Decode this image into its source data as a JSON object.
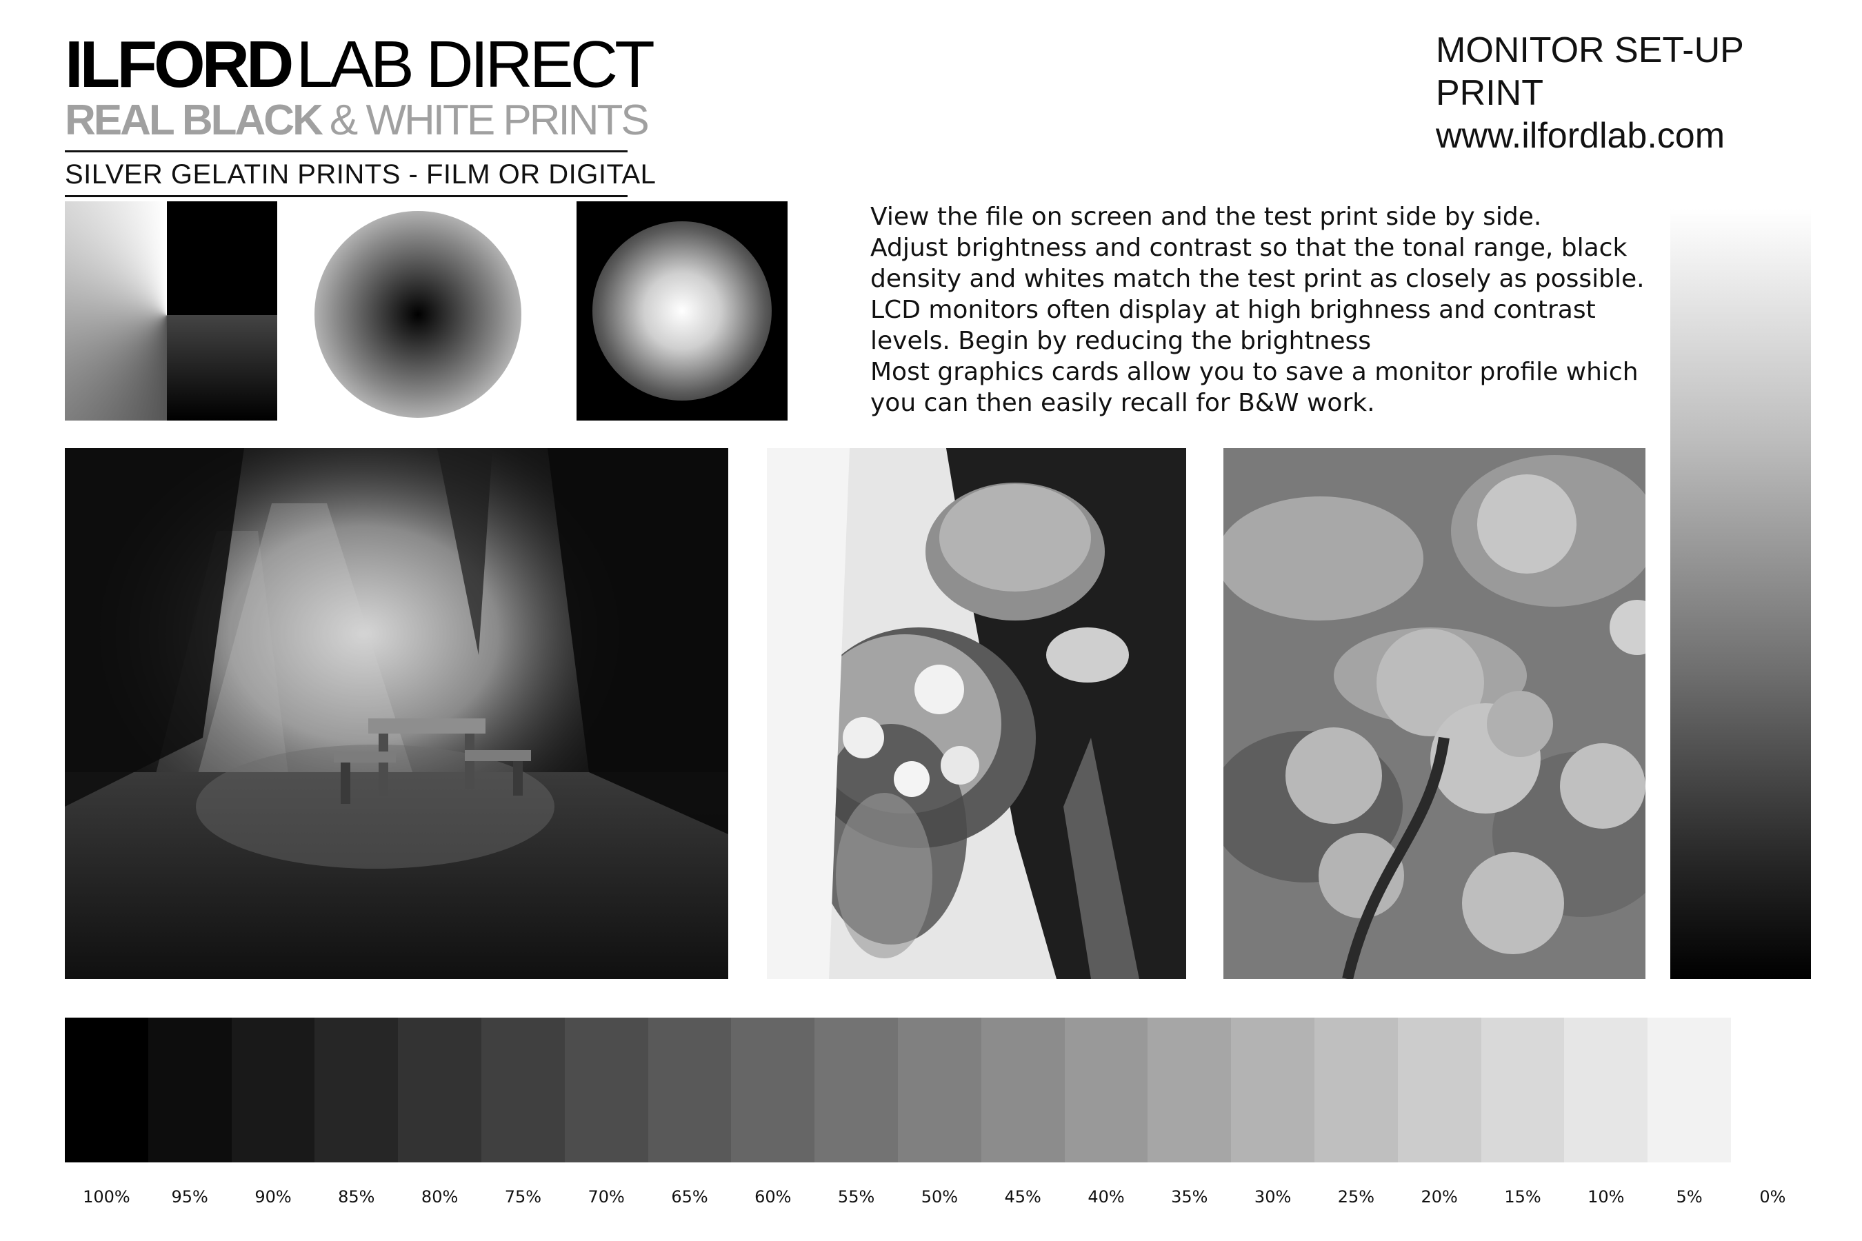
{
  "logo": {
    "line1_bold": "ILFORD",
    "line1_light": "LAB DIRECT",
    "line2_bold": "REAL BLACK",
    "line2_light": "& WHITE PRINTS",
    "line3": "SILVER GELATIN PRINTS - FILM OR DIGITAL"
  },
  "header": {
    "title": "MONITOR SET-UP PRINT",
    "url": "www.ilfordlab.com"
  },
  "instructions": [
    "View the file on screen and the test print side by side.",
    "Adjust brightness and contrast so that the tonal range, black",
    "density and whites match the test print as closely as possible.",
    "LCD monitors often display at high brighness and contrast",
    "levels. Begin by reducing the brightness",
    "Most graphics cards allow you to save a monitor profile which",
    "you can then easily recall for B&W work."
  ],
  "step_wedge": {
    "labels": [
      "100%",
      "95%",
      "90%",
      "85%",
      "80%",
      "75%",
      "70%",
      "65%",
      "60%",
      "55%",
      "50%",
      "45%",
      "40%",
      "35%",
      "30%",
      "25%",
      "20%",
      "15%",
      "10%",
      "5%",
      "0%"
    ],
    "values": [
      100,
      95,
      90,
      85,
      80,
      75,
      70,
      65,
      60,
      55,
      50,
      45,
      40,
      35,
      30,
      25,
      20,
      15,
      10,
      5,
      0
    ]
  },
  "photos": {
    "forest": "forest-bench-photo",
    "wedding": "wedding-bouquet-photo",
    "apples": "apples-branch-photo"
  },
  "colors": {
    "logo_black": "#000000",
    "logo_grey": "#a0a0a0"
  }
}
